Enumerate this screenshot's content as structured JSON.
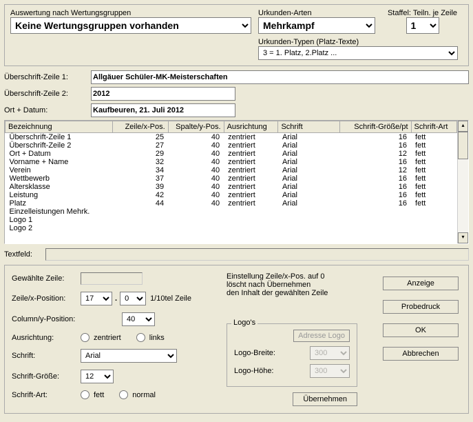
{
  "top": {
    "auswertung_label": "Auswertung nach Wertungsgruppen",
    "auswertung_value": "Keine Wertungsgruppen vorhanden",
    "urkunden_arten_label": "Urkunden-Arten",
    "urkunden_arten_value": "Mehrkampf",
    "staffel_label": "Staffel: Teiln. je Zeile",
    "staffel_value": "1",
    "urkunden_typen_label": "Urkunden-Typen (Platz-Texte)",
    "urkunden_typen_value": "3 = 1. Platz, 2.Platz ..."
  },
  "headers": {
    "u1_label": "Überschrift-Zeile 1:",
    "u1_value": "Allgäuer Schüler-MK-Meisterschaften",
    "u2_label": "Überschrift-Zeile 2:",
    "u2_value": "2012",
    "ort_label": "Ort + Datum:",
    "ort_value": "Kaufbeuren, 21. Juli 2012"
  },
  "table": {
    "cols": [
      "Bezeichnung",
      "Zeile/x-Pos.",
      "Spalte/y-Pos.",
      "Ausrichtung",
      "Schrift",
      "Schrift-Größe/pt",
      "Schrift-Art"
    ],
    "rows": [
      [
        "Überschrift-Zeile 1",
        "25",
        "40",
        "zentriert",
        "Arial",
        "16",
        "fett"
      ],
      [
        "Überschrift-Zeile 2",
        "27",
        "40",
        "zentriert",
        "Arial",
        "16",
        "fett"
      ],
      [
        "Ort + Datum",
        "29",
        "40",
        "zentriert",
        "Arial",
        "12",
        "fett"
      ],
      [
        "Vorname + Name",
        "32",
        "40",
        "zentriert",
        "Arial",
        "16",
        "fett"
      ],
      [
        "Verein",
        "34",
        "40",
        "zentriert",
        "Arial",
        "12",
        "fett"
      ],
      [
        "Wettbewerb",
        "37",
        "40",
        "zentriert",
        "Arial",
        "16",
        "fett"
      ],
      [
        "Altersklasse",
        "39",
        "40",
        "zentriert",
        "Arial",
        "16",
        "fett"
      ],
      [
        "Leistung",
        "42",
        "40",
        "zentriert",
        "Arial",
        "16",
        "fett"
      ],
      [
        "Platz",
        "44",
        "40",
        "zentriert",
        "Arial",
        "16",
        "fett"
      ],
      [
        "Einzelleistungen Mehrk.",
        "",
        "",
        "",
        "",
        "",
        ""
      ],
      [
        "Logo 1",
        "",
        "",
        "",
        "",
        "",
        ""
      ],
      [
        "Logo 2",
        "",
        "",
        "",
        "",
        "",
        ""
      ]
    ]
  },
  "textfeld_label": "Textfeld:",
  "form": {
    "gewaehlte_label": "Gewählte Zeile:",
    "zeile_label": "Zeile/x-Position:",
    "zeile_val1": "17",
    "zeile_sep": ".",
    "zeile_val2": "0",
    "zeile_suffix": "1/10tel Zeile",
    "col_label": "Column/y-Position:",
    "col_value": "40",
    "ausrichtung_label": "Ausrichtung:",
    "ausrichtung_opt1": "zentriert",
    "ausrichtung_opt2": "links",
    "schrift_label": "Schrift:",
    "schrift_value": "Arial",
    "schrift_groesse_label": "Schrift-Größe:",
    "schrift_groesse_value": "12",
    "schrift_art_label": "Schrift-Art:",
    "schrift_art_opt1": "fett",
    "schrift_art_opt2": "normal"
  },
  "einstellung": {
    "line1": "Einstellung Zeile/x-Pos. auf  0",
    "line2": "löscht nach  Übernehmen",
    "line3": "den Inhalt der gewählten Zeile",
    "logos_title": "Logo's",
    "adresse_btn": "Adresse Logo",
    "breite_label": "Logo-Breite:",
    "breite_value": "300",
    "hoehe_label": "Logo-Höhe:",
    "hoehe_value": "300",
    "uebernehmen_btn": "Übernehmen"
  },
  "buttons": {
    "anzeige": "Anzeige",
    "probedruck": "Probedruck",
    "ok": "OK",
    "abbrechen": "Abbrechen"
  }
}
